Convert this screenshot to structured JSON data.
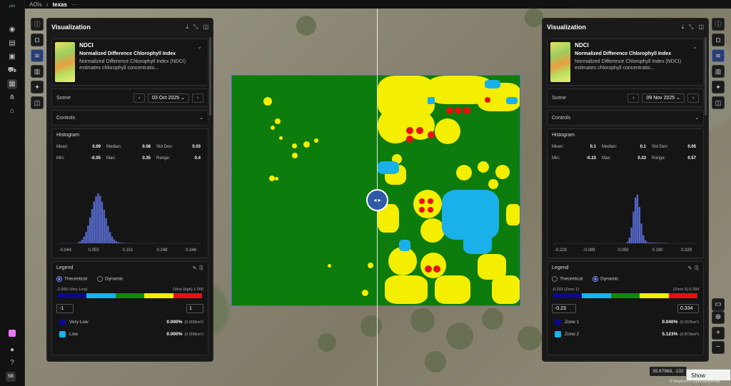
{
  "breadcrumb": {
    "root": "AOIs",
    "current": "texas",
    "more": "···"
  },
  "rail": {
    "logo": "plnt",
    "avatar": "SB"
  },
  "panels": [
    {
      "title": "Visualization",
      "layer": {
        "code": "NDCI",
        "name": "Normalized Difference Chlorophyll Index",
        "description": "Normalized Difference Chlorophyll Index (NDCI) estimates chlorophyll concentratio..."
      },
      "scene": {
        "label": "Scene",
        "date": "03 Oct 2025"
      },
      "controls_label": "Controls",
      "histogram": {
        "title": "Histogram",
        "stats": [
          {
            "label": "Mean:",
            "value": "0.09"
          },
          {
            "label": "Median:",
            "value": "0.08"
          },
          {
            "label": "Std Dev:",
            "value": "0.03"
          },
          {
            "label": "Min:",
            "value": "-0.05"
          },
          {
            "label": "Max:",
            "value": "0.35"
          },
          {
            "label": "Range:",
            "value": "0.4"
          }
        ],
        "ticks": [
          "-0.044",
          "0.053",
          "0.151",
          "0.248",
          "0.346"
        ]
      },
      "legend": {
        "title": "Legend",
        "modes": [
          "Theoretical",
          "Dynamic"
        ],
        "selected_mode": "Theoretical",
        "ramp_low": "-1.000 (Very Low)",
        "ramp_high": "(Very High) 1.000",
        "input_min": "-1",
        "input_max": "1",
        "classes": [
          {
            "name": "Very Low",
            "percent": "0.000%",
            "area": "(0.000km²)",
            "color": "#0a0a8a"
          },
          {
            "name": "Low",
            "percent": "0.000%",
            "area": "(0.000km²)",
            "color": "#14b4ec"
          }
        ]
      }
    },
    {
      "title": "Visualization",
      "layer": {
        "code": "NDCI",
        "name": "Normalized Difference Chlorophyll Index",
        "description": "Normalized Difference Chlorophyll Index (NDCI) estimates chlorophyll concentratio..."
      },
      "scene": {
        "label": "Scene",
        "date": "09 Nov 2025"
      },
      "controls_label": "Controls",
      "histogram": {
        "title": "Histogram",
        "stats": [
          {
            "label": "Mean:",
            "value": "0.1"
          },
          {
            "label": "Median:",
            "value": "0.1"
          },
          {
            "label": "Std Dev:",
            "value": "0.05"
          },
          {
            "label": "Min:",
            "value": "-0.23"
          },
          {
            "label": "Max:",
            "value": "0.33"
          },
          {
            "label": "Range:",
            "value": "0.57"
          }
        ],
        "ticks": [
          "-0.228",
          "-0.089",
          "0.050",
          "0.190",
          "0.329"
        ]
      },
      "legend": {
        "title": "Legend",
        "modes": [
          "Theoretical",
          "Dynamic"
        ],
        "selected_mode": "Dynamic",
        "ramp_low": "-0.233 (Zone 1)",
        "ramp_high": "(Zone 5) 0.334",
        "input_min": "-0.23",
        "input_max": "0.334",
        "classes": [
          {
            "name": "Zone 1",
            "percent": "0.040%",
            "area": "(0.007km²)",
            "color": "#0a0a8a"
          },
          {
            "name": "Zone 2",
            "percent": "5.123%",
            "area": "(0.873km²)",
            "color": "#14b4ec"
          }
        ]
      }
    }
  ],
  "ramp_colors": [
    "#0a0a8a",
    "#14b4ec",
    "#0e8a0e",
    "#f4ee00",
    "#e81010"
  ],
  "map": {
    "coords": "35.67968, -102",
    "attribution": "© Mapbox © OpenStreetMap",
    "tooltip": "Show desktop"
  }
}
